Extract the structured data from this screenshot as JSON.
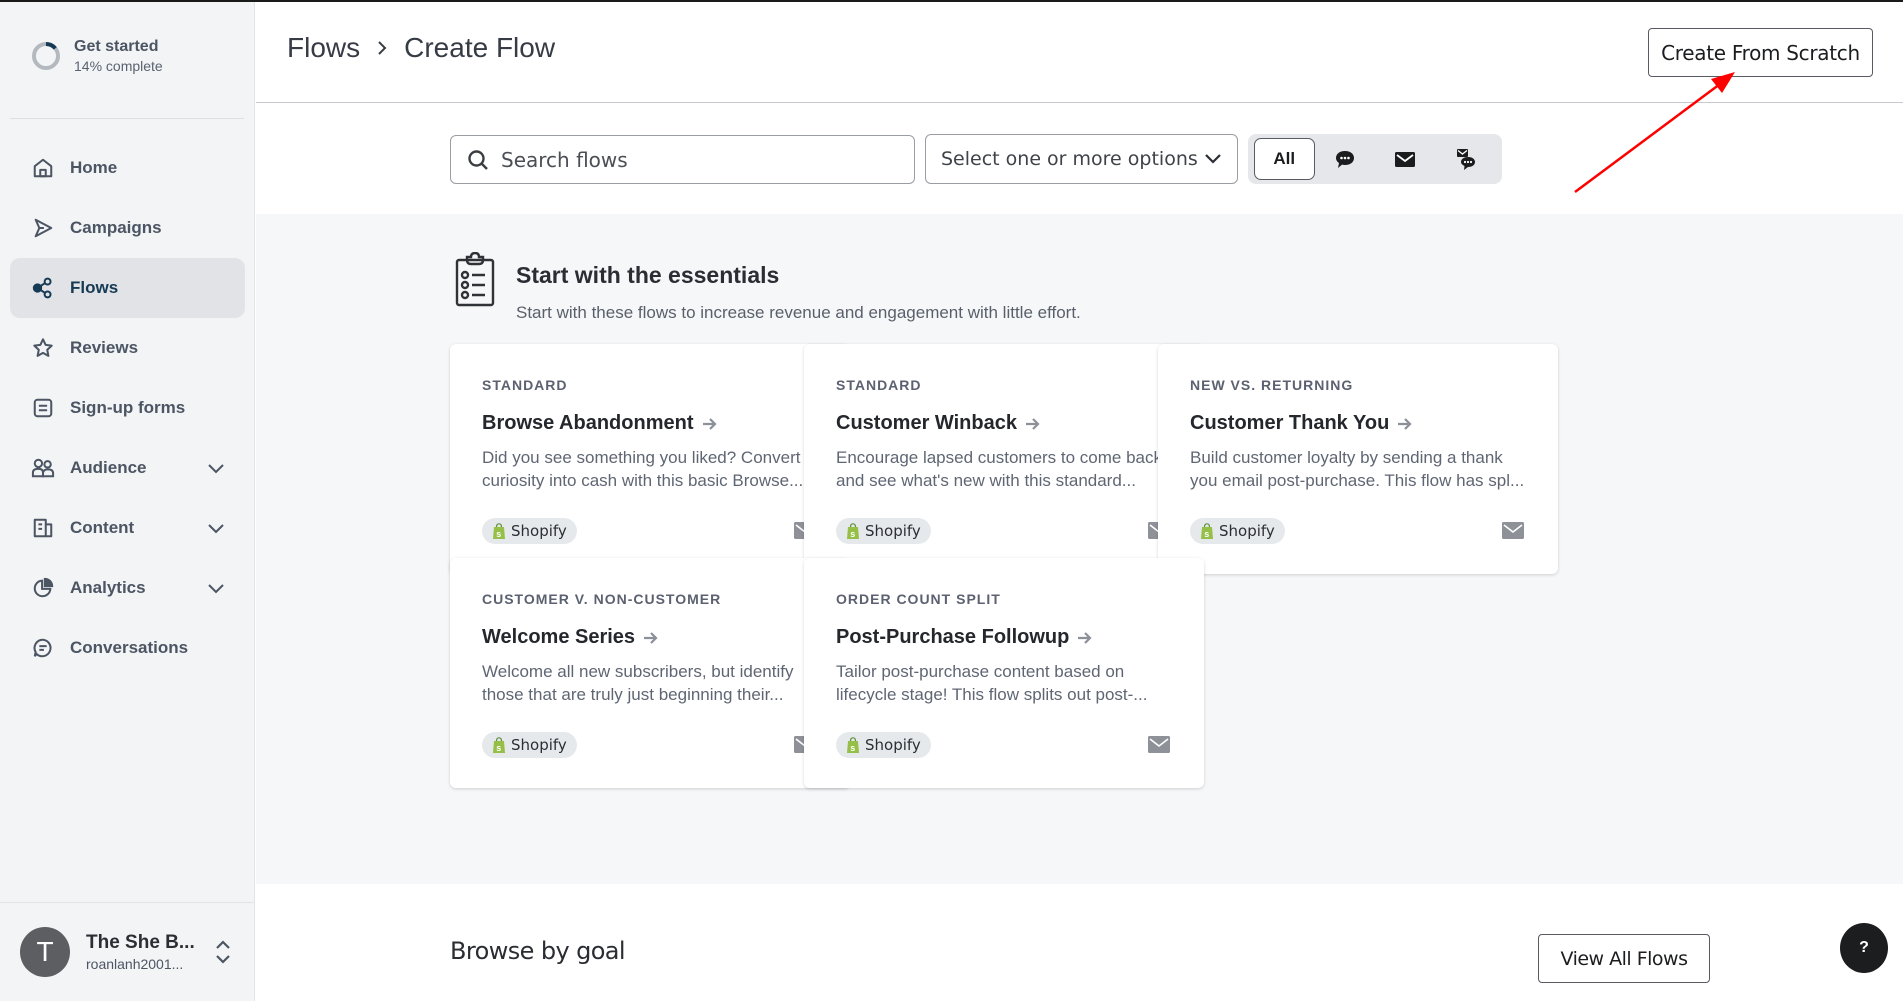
{
  "sidebar": {
    "get_started": {
      "title": "Get started",
      "progress_label": "14% complete",
      "progress": 0.14
    },
    "items": [
      {
        "label": "Home",
        "icon": "home-icon",
        "active": false,
        "expandable": false
      },
      {
        "label": "Campaigns",
        "icon": "send-icon",
        "active": false,
        "expandable": false
      },
      {
        "label": "Flows",
        "icon": "flows-icon",
        "active": true,
        "expandable": false
      },
      {
        "label": "Reviews",
        "icon": "star-icon",
        "active": false,
        "expandable": false
      },
      {
        "label": "Sign-up forms",
        "icon": "form-icon",
        "active": false,
        "expandable": false
      },
      {
        "label": "Audience",
        "icon": "people-icon",
        "active": false,
        "expandable": true
      },
      {
        "label": "Content",
        "icon": "content-icon",
        "active": false,
        "expandable": true
      },
      {
        "label": "Analytics",
        "icon": "pie-chart-icon",
        "active": false,
        "expandable": true
      },
      {
        "label": "Conversations",
        "icon": "chat-icon",
        "active": false,
        "expandable": false
      }
    ],
    "account": {
      "initial": "T",
      "name": "The She B...",
      "email": "roanlanh2001..."
    }
  },
  "header": {
    "breadcrumb": [
      "Flows",
      "Create Flow"
    ],
    "create_button": "Create From Scratch"
  },
  "filters": {
    "search_placeholder": "Search flows",
    "select_placeholder": "Select one or more options",
    "channels": [
      {
        "label": "All",
        "icon": null,
        "active": true
      },
      {
        "label": "",
        "icon": "sms-icon",
        "active": false
      },
      {
        "label": "",
        "icon": "email-icon",
        "active": false
      },
      {
        "label": "",
        "icon": "email-sms-icon",
        "active": false
      }
    ]
  },
  "essentials": {
    "title": "Start with the essentials",
    "subtitle": "Start with these flows to increase revenue and engagement with little effort.",
    "cards": [
      {
        "tag": "STANDARD",
        "name": "Browse Abandonment",
        "desc": "Did you see something you liked? Convert curiosity into cash with this basic Browse...",
        "badge": "Shopify",
        "channel": "email"
      },
      {
        "tag": "STANDARD",
        "name": "Customer Winback",
        "desc": "Encourage lapsed customers to come back and see what's new with this standard...",
        "badge": "Shopify",
        "channel": "email"
      },
      {
        "tag": "NEW VS. RETURNING",
        "name": "Customer Thank You",
        "desc": "Build customer loyalty by sending a thank you email post-purchase. This flow has spl...",
        "badge": "Shopify",
        "channel": "email"
      },
      {
        "tag": "CUSTOMER V. NON-CUSTOMER",
        "name": "Welcome Series",
        "desc": "Welcome all new subscribers, but identify those that are truly just beginning their...",
        "badge": "Shopify",
        "channel": "email"
      },
      {
        "tag": "ORDER COUNT SPLIT",
        "name": "Post-Purchase Followup",
        "desc": "Tailor post-purchase content based on lifecycle stage! This flow splits out post-...",
        "badge": "Shopify",
        "channel": "email"
      }
    ]
  },
  "browse_goal": {
    "title": "Browse by goal",
    "view_all": "View All Flows"
  },
  "help": {
    "label": "?"
  },
  "colors": {
    "accent": "#163a54",
    "annotation": "#ff0000",
    "shopify": "#95bf47"
  }
}
